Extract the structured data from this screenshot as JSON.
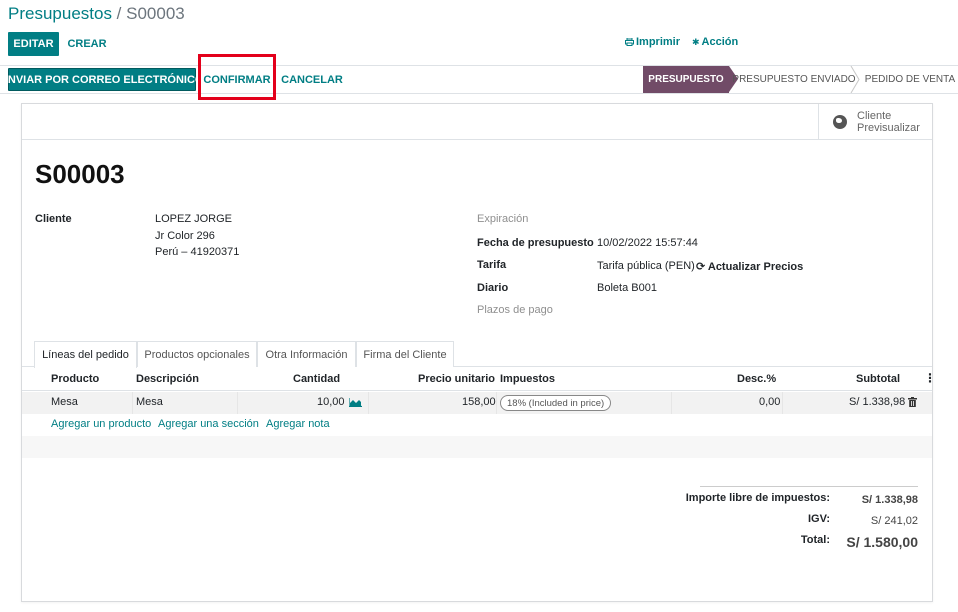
{
  "breadcrumb": {
    "parent": "Presupuestos",
    "separator": " / ",
    "current": "S00003"
  },
  "control": {
    "edit_label": "EDITAR",
    "create_label": "CREAR",
    "print_label": "Imprimir",
    "action_label": "Acción"
  },
  "header": {
    "send_email_label": "ENVIAR POR CORREO ELECTRÓNICO",
    "confirm_label": "CONFIRMAR",
    "cancel_label": "CANCELAR",
    "stages": [
      "PRESUPUESTO",
      "PRESUPUESTO ENVIADO",
      "PEDIDO DE VENTA"
    ],
    "active_stage_color": "#714b67"
  },
  "preview": {
    "line1": "Cliente",
    "line2": "Previsualizar"
  },
  "record": {
    "name": "S00003"
  },
  "customer": {
    "label": "Cliente",
    "name": "LOPEZ JORGE",
    "street": "Jr Color 296",
    "country_phone": "Perú – 41920371"
  },
  "info": {
    "expiration_label": "Expiración",
    "date_label": "Fecha de presupuesto",
    "date_value": "10/02/2022 15:57:44",
    "pricelist_label": "Tarifa",
    "pricelist_value": "Tarifa pública (PEN)",
    "update_prices_label": "Actualizar Precios",
    "journal_label": "Diario",
    "journal_value": "Boleta B001",
    "payment_terms_label": "Plazos de pago"
  },
  "tabs": [
    "Líneas del pedido",
    "Productos opcionales",
    "Otra Información",
    "Firma del Cliente"
  ],
  "table": {
    "columns": [
      "Producto",
      "Descripción",
      "Cantidad",
      "Precio unitario",
      "Impuestos",
      "Desc.%",
      "Subtotal"
    ],
    "rows": [
      {
        "product": "Mesa",
        "description": "Mesa",
        "quantity": "10,00",
        "price": "158,00",
        "tax": "18% (Included in price)",
        "discount": "0,00",
        "subtotal": "S/ 1.338,98"
      }
    ],
    "add_product": "Agregar un producto",
    "add_section": "Agregar una sección",
    "add_note": "Agregar nota"
  },
  "totals": {
    "untaxed_label": "Importe libre de impuestos:",
    "untaxed_value": "S/ 1.338,98",
    "tax_label": "IGV:",
    "tax_value": "S/ 241,02",
    "total_label": "Total:",
    "total_value": "S/ 1.580,00"
  },
  "colors": {
    "primary": "#017e84",
    "highlight": "#e3001b"
  }
}
